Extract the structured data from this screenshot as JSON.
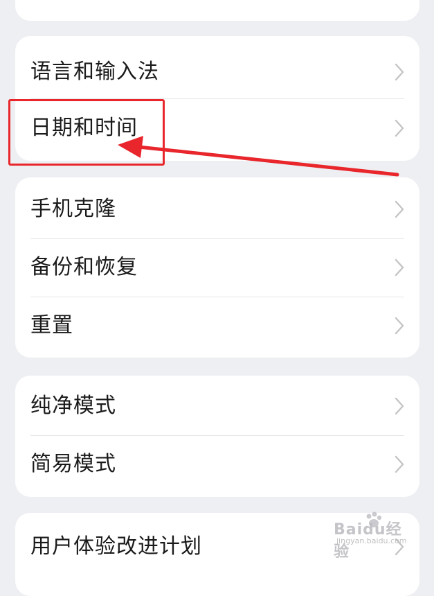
{
  "settings": {
    "group_language": {
      "items": [
        {
          "label": "语言和输入法"
        },
        {
          "label": "日期和时间"
        }
      ]
    },
    "group_backup": {
      "items": [
        {
          "label": "手机克隆"
        },
        {
          "label": "备份和恢复"
        },
        {
          "label": "重置"
        }
      ]
    },
    "group_mode": {
      "items": [
        {
          "label": "纯净模式"
        },
        {
          "label": "简易模式"
        }
      ]
    },
    "group_bottom": {
      "items": [
        {
          "label": "用户体验改进计划"
        }
      ]
    }
  },
  "annotation": {
    "color": "#e8262b",
    "highlighted_item": "日期和时间"
  },
  "watermark": {
    "logo_text": "Baidu经验",
    "sub_text": "jingyan.baidu.com"
  },
  "colors": {
    "background": "#eeeff2",
    "card": "#ffffff",
    "text": "#1a1a1a",
    "chevron": "#c4c4c4",
    "divider": "#e6e6e6"
  }
}
